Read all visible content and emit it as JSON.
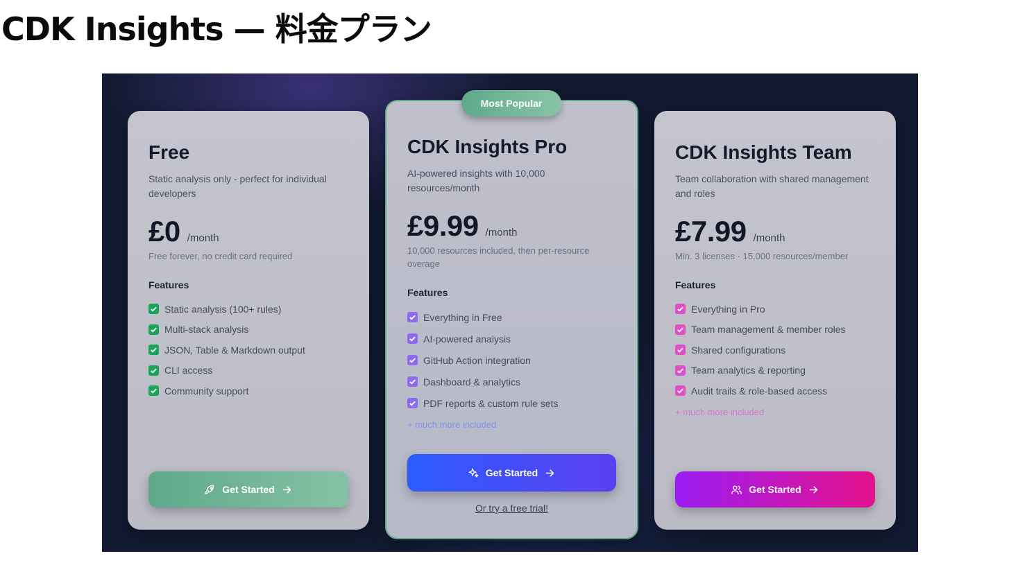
{
  "page": {
    "title": "CDK Insights — 料金プラン"
  },
  "plans": {
    "free": {
      "name": "Free",
      "description": "Static analysis only - perfect for individual developers",
      "price": "£0",
      "per": "/month",
      "note": "Free forever, no credit card required",
      "features_title": "Features",
      "features": [
        "Static analysis (100+ rules)",
        "Multi-stack analysis",
        "JSON, Table & Markdown output",
        "CLI access",
        "Community support"
      ],
      "cta": "Get Started",
      "cta_icon": "rocket-icon"
    },
    "pro": {
      "badge": "Most Popular",
      "name": "CDK Insights Pro",
      "description": "AI-powered insights with 10,000 resources/month",
      "price": "£9.99",
      "per": "/month",
      "note": "10,000 resources included, then per-resource overage",
      "features_title": "Features",
      "features": [
        "Everything in Free",
        "AI-powered analysis",
        "GitHub Action integration",
        "Dashboard & analytics",
        "PDF reports & custom rule sets"
      ],
      "more": "+ much more included",
      "cta": "Get Started",
      "cta_icon": "sparkles-icon",
      "trial_link": "Or try a free trial!"
    },
    "team": {
      "name": "CDK Insights Team",
      "description": "Team collaboration with shared management and roles",
      "price": "£7.99",
      "per": "/month",
      "note": "Min. 3 licenses · 15,000 resources/member",
      "features_title": "Features",
      "features": [
        "Everything in Pro",
        "Team management & member roles",
        "Shared configurations",
        "Team analytics & reporting",
        "Audit trails & role-based access"
      ],
      "more": "+ much more included",
      "cta": "Get Started",
      "cta_icon": "users-icon"
    }
  },
  "colors": {
    "background": "#121a31",
    "free_accent": "#5fa98a",
    "pro_accent": "#2c5cfd",
    "team_accent": "#9b1cf2",
    "team_accent_end": "#e4128b"
  }
}
